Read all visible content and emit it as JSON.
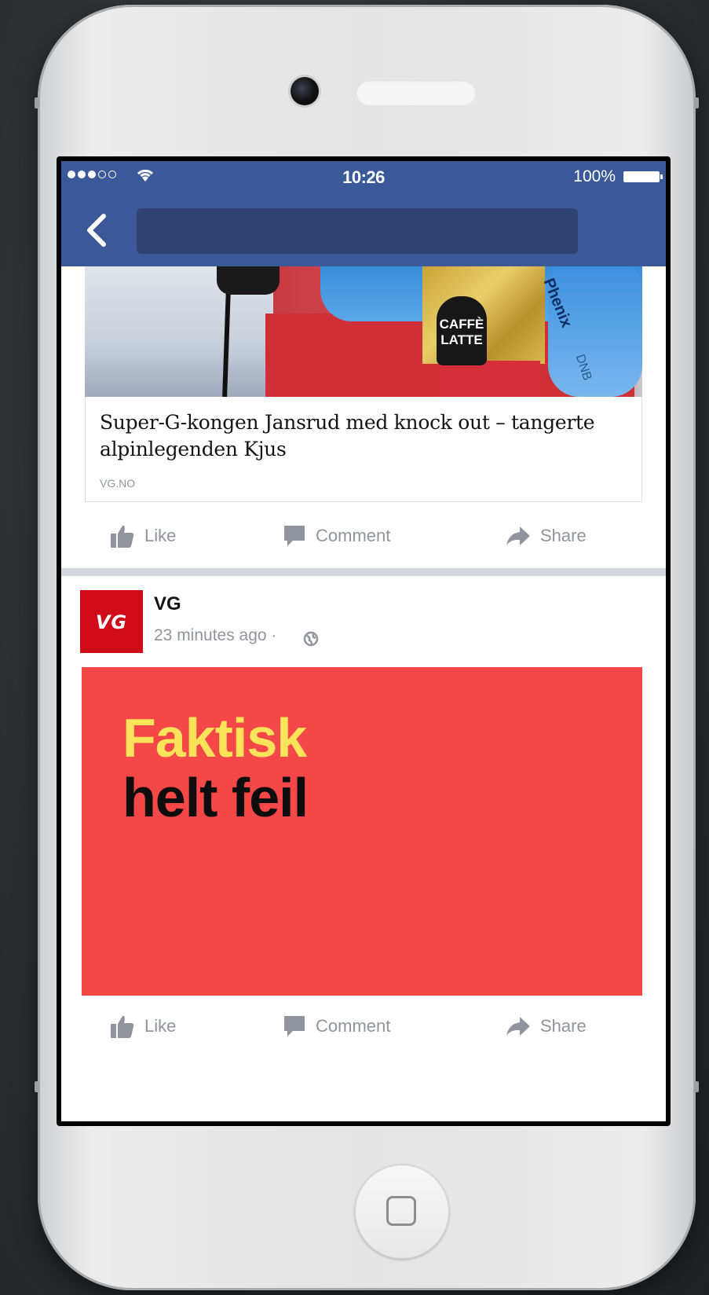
{
  "status_bar": {
    "signal_filled": 3,
    "signal_total": 5,
    "time": "10:26",
    "battery_percent": "100%"
  },
  "nav": {
    "back_icon": "chevron-left-icon",
    "search_placeholder": ""
  },
  "post1": {
    "image_text": {
      "bib": "CAFFÈ LATTE",
      "brand": "Phenix",
      "sponsor": "DNB"
    },
    "link_title": "Super-G-kongen Jansrud med knock out – tangerte alpinlegenden Kjus",
    "link_source": "VG.NO",
    "actions": {
      "like": "Like",
      "comment": "Comment",
      "share": "Share"
    }
  },
  "post2": {
    "page_logo_text": "VG",
    "page_name": "VG",
    "timestamp": "23 minutes ago ·",
    "privacy_icon": "globe-icon",
    "image": {
      "line1": "Faktisk",
      "line2": "helt feil",
      "background_color": "#f44848",
      "line1_color": "#fbe35a"
    },
    "actions": {
      "like": "Like",
      "comment": "Comment",
      "share": "Share"
    }
  },
  "colors": {
    "facebook_blue": "#3b5998",
    "vg_red": "#d00c1a",
    "action_gray": "#90949c"
  }
}
